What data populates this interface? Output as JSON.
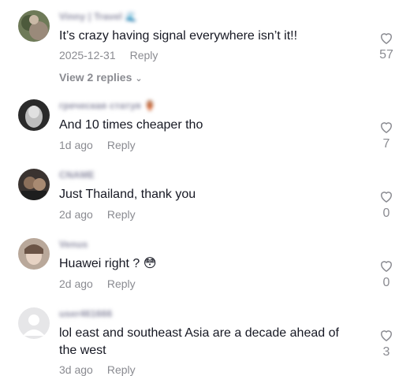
{
  "comments": [
    {
      "username": "Vinny | Travel 🌊",
      "text": "It’s crazy having signal everywhere isn’t it!!",
      "date": "2025-12-31",
      "reply_label": "Reply",
      "likes": "57",
      "view_replies": "View 2 replies"
    },
    {
      "username": "греческая статуя 🏺",
      "text": "And 10 times cheaper tho",
      "date": "1d ago",
      "reply_label": "Reply",
      "likes": "7"
    },
    {
      "username": "CNAME",
      "text": "Just Thailand, thank you",
      "date": "2d ago",
      "reply_label": "Reply",
      "likes": "0"
    },
    {
      "username": "Venus",
      "text": "Huawei right ? 😳",
      "date": "2d ago",
      "reply_label": "Reply",
      "likes": "0"
    },
    {
      "username": "user461666",
      "text": "lol east and southeast Asia are a decade ahead of the west",
      "date": "3d ago",
      "reply_label": "Reply",
      "likes": "3"
    }
  ],
  "colors": {
    "text": "#161823",
    "muted": "#8a8b91",
    "username": "#8a8aa0"
  },
  "icons": {
    "like": "heart-outline-icon",
    "expand": "chevron-down-icon"
  }
}
